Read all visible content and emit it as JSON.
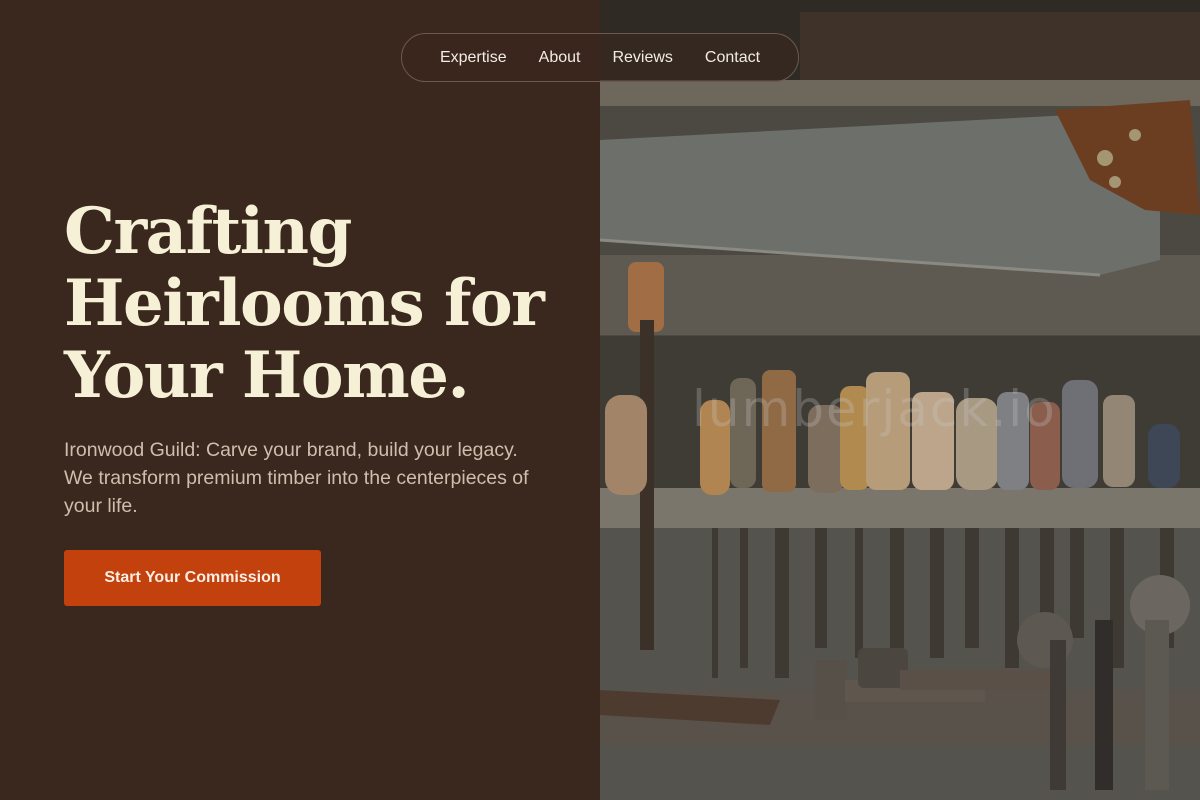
{
  "nav": {
    "items": [
      {
        "label": "Expertise"
      },
      {
        "label": "About"
      },
      {
        "label": "Reviews"
      },
      {
        "label": "Contact"
      }
    ]
  },
  "hero": {
    "title_lines": [
      "Crafting",
      "Heirlooms for",
      "Your Home."
    ],
    "subtitle": "Ironwood Guild: Carve your brand, build your legacy. We transform premium timber into the centerpieces of your life.",
    "cta_label": "Start Your Commission"
  },
  "photo": {
    "watermark": "lumberjack.io"
  },
  "colors": {
    "background": "#3a271d",
    "headline": "#f5f0d6",
    "body_text": "#cdbfae",
    "accent": "#c2410c"
  }
}
